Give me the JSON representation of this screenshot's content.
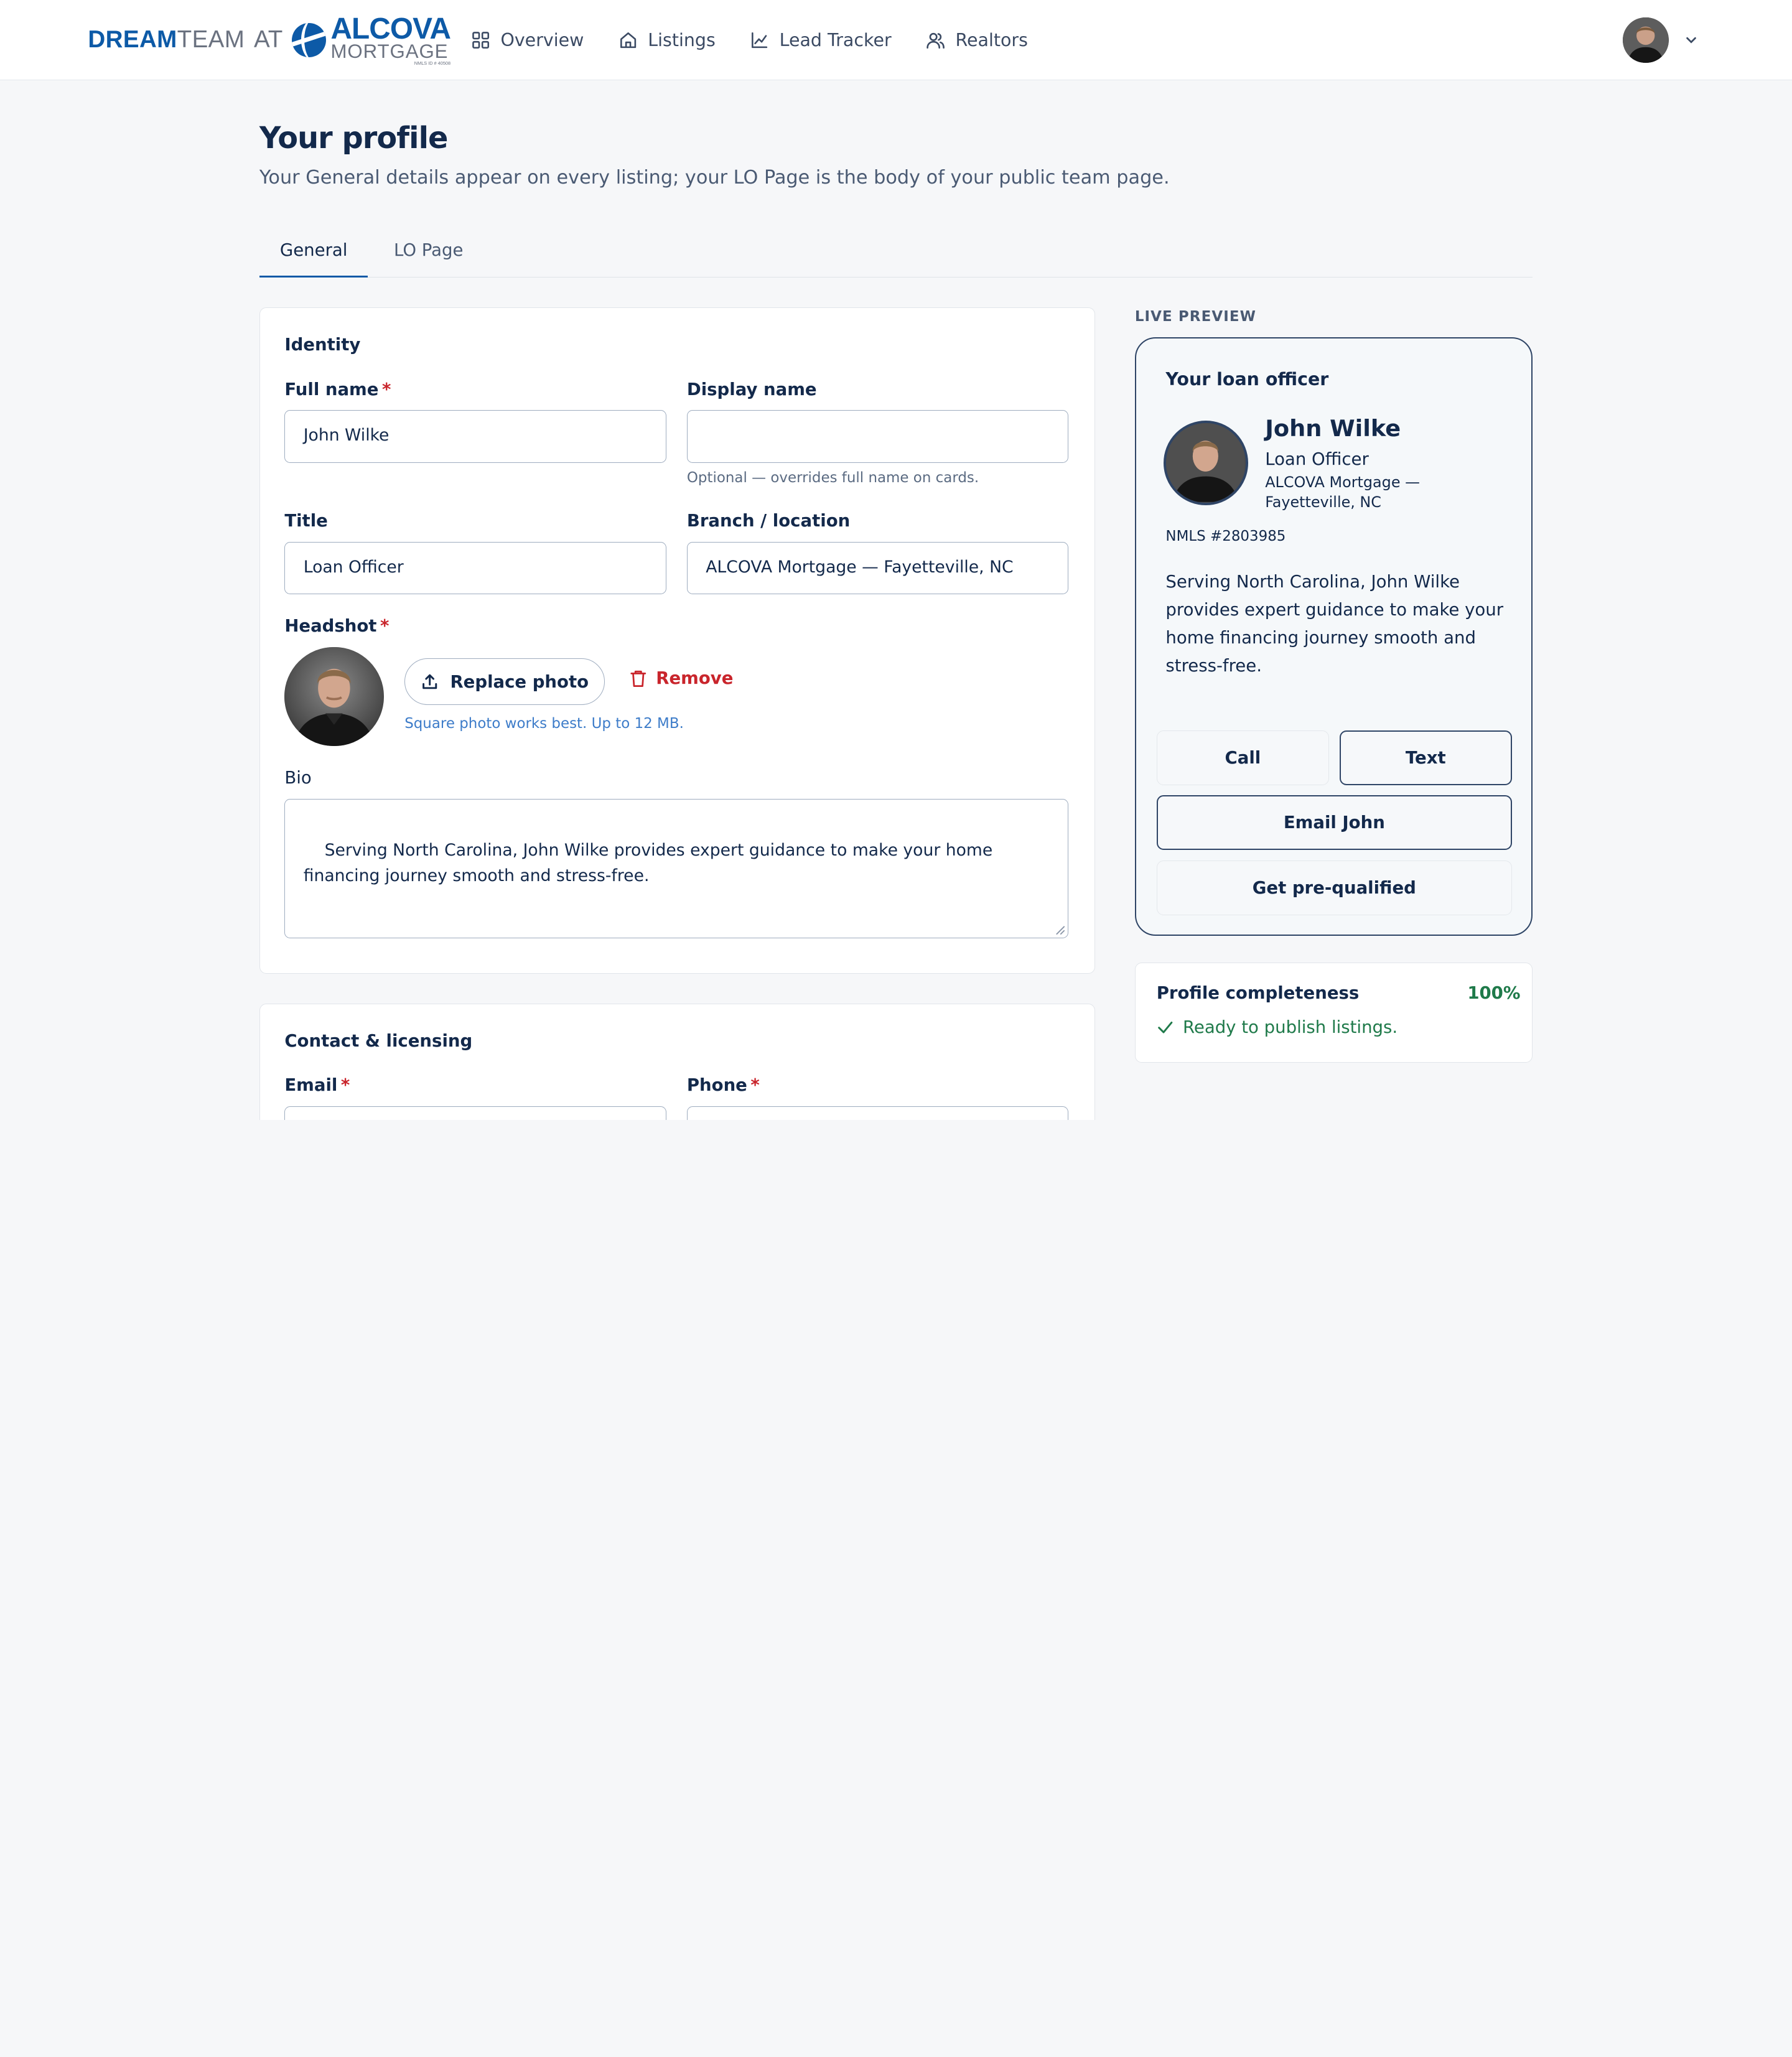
{
  "brand": {
    "dream": "DREAM",
    "team": "TEAM",
    "at": "AT",
    "company": "ALCOVA",
    "company_sub": "MORTGAGE",
    "nmls": "NMLS ID # 40508"
  },
  "nav": {
    "items": [
      {
        "label": "Overview",
        "icon": "grid-icon"
      },
      {
        "label": "Listings",
        "icon": "home-icon"
      },
      {
        "label": "Lead Tracker",
        "icon": "chart-icon"
      },
      {
        "label": "Realtors",
        "icon": "users-icon"
      }
    ]
  },
  "header": {
    "title": "Your profile",
    "subtitle": "Your General details appear on every listing; your LO Page is the body of your public team page."
  },
  "tabs": [
    {
      "label": "General",
      "active": true
    },
    {
      "label": "LO Page",
      "active": false
    }
  ],
  "identity": {
    "section_title": "Identity",
    "full_name_label": "Full name",
    "full_name_value": "John Wilke",
    "display_name_label": "Display name",
    "display_name_value": "",
    "display_name_helper": "Optional — overrides full name on cards.",
    "title_label": "Title",
    "title_value": "Loan Officer",
    "branch_label": "Branch / location",
    "branch_value": "ALCOVA Mortgage — Fayetteville, NC",
    "headshot_label": "Headshot",
    "replace_label": "Replace photo",
    "remove_label": "Remove",
    "headshot_helper": "Square photo works best. Up to 12 MB.",
    "bio_label": "Bio",
    "bio_value": "Serving North Carolina, John Wilke provides expert guidance to make your home financing journey smooth and stress-free.",
    "required_mark": "*"
  },
  "contact": {
    "section_title": "Contact & licensing",
    "email_label": "Email",
    "phone_label": "Phone"
  },
  "preview": {
    "label": "LIVE PREVIEW",
    "heading": "Your loan officer",
    "name": "John Wilke",
    "title": "Loan Officer",
    "branch": "ALCOVA Mortgage — Fayetteville, NC",
    "nmls": "NMLS #2803985",
    "bio": "Serving North Carolina, John Wilke provides expert guidance to make your home financing journey smooth and stress-free.",
    "call_label": "Call",
    "text_label": "Text",
    "email_label": "Email John",
    "prequal_label": "Get pre-qualified"
  },
  "completeness": {
    "label": "Profile completeness",
    "percent": "100%",
    "status": "Ready to publish listings."
  },
  "colors": {
    "brand_blue": "#0d5aa7",
    "navy": "#13294b",
    "required_red": "#c9252c",
    "success_green": "#1f7a4a"
  }
}
